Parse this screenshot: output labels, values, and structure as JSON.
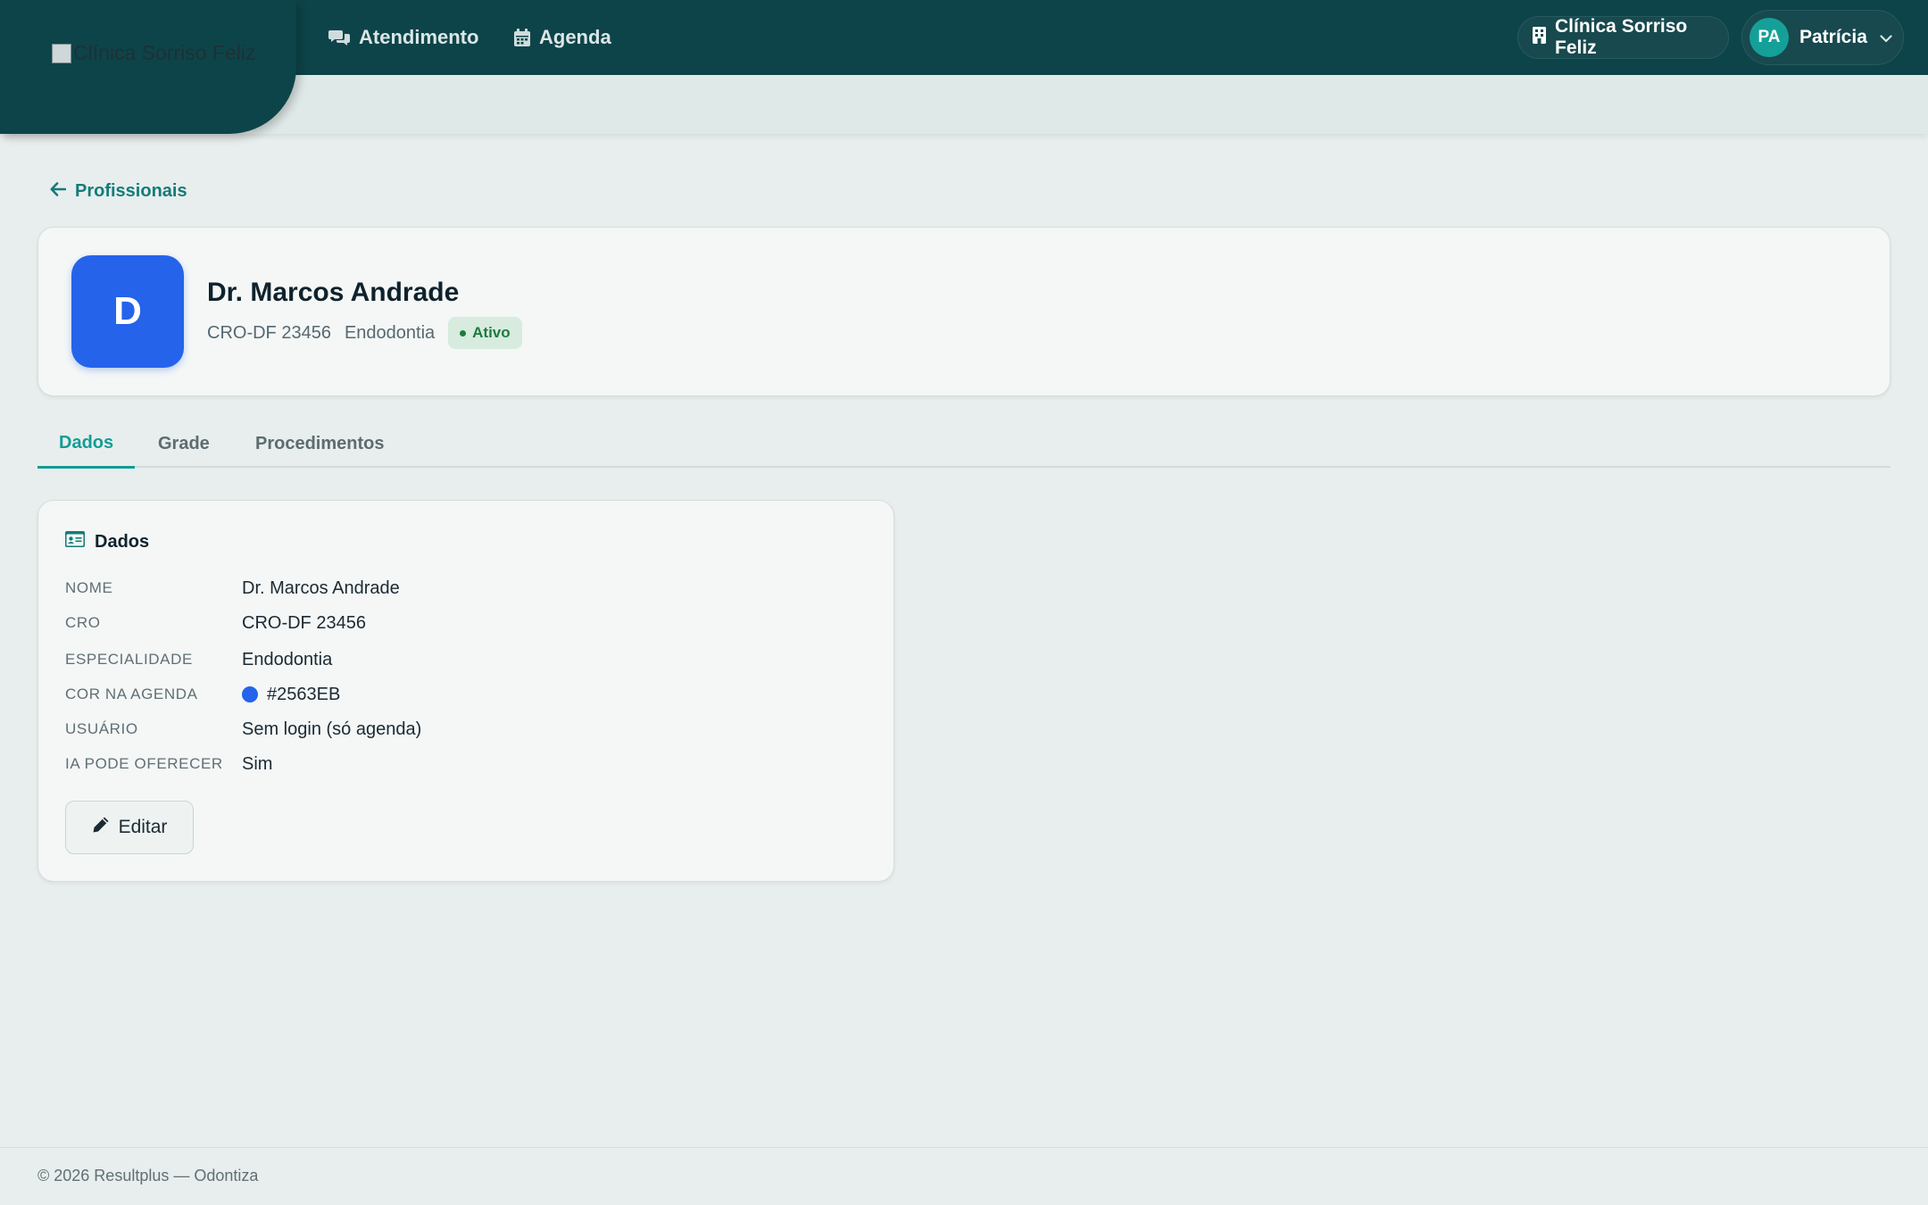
{
  "brand": {
    "logo_alt": "Clínica Sorriso Feliz"
  },
  "nav": {
    "items": [
      {
        "label": "Atendimento",
        "icon": "chat-bubbles-icon"
      },
      {
        "label": "Agenda",
        "icon": "calendar-icon"
      }
    ]
  },
  "header": {
    "clinic_name": "Clínica Sorriso Feliz",
    "user_initials": "PA",
    "user_name": "Patrícia"
  },
  "breadcrumb": {
    "back_label": "Profissionais"
  },
  "profile": {
    "avatar_letter": "D",
    "name": "Dr. Marcos Andrade",
    "cro": "CRO-DF 23456",
    "specialty": "Endodontia",
    "status": "Ativo"
  },
  "tabs": [
    {
      "label": "Dados",
      "active": true
    },
    {
      "label": "Grade",
      "active": false
    },
    {
      "label": "Procedimentos",
      "active": false
    }
  ],
  "details": {
    "title": "Dados",
    "rows": [
      {
        "label": "NOME",
        "value": "Dr. Marcos Andrade"
      },
      {
        "label": "CRO",
        "value": "CRO-DF 23456"
      },
      {
        "label": "ESPECIALIDADE",
        "value": "Endodontia"
      },
      {
        "label": "COR NA AGENDA",
        "value": "#2563EB"
      },
      {
        "label": "USUÁRIO",
        "value": "Sem login (só agenda)"
      },
      {
        "label": "IA PODE OFERECER",
        "value": "Sim"
      }
    ],
    "edit_label": "Editar"
  },
  "colors": {
    "topbar": "#0d4449",
    "accent": "#139c95",
    "agenda_color": "#2563eb",
    "status_green": "#1e7a3e"
  },
  "footer": {
    "text": "© 2026 Resultplus — Odontiza"
  }
}
